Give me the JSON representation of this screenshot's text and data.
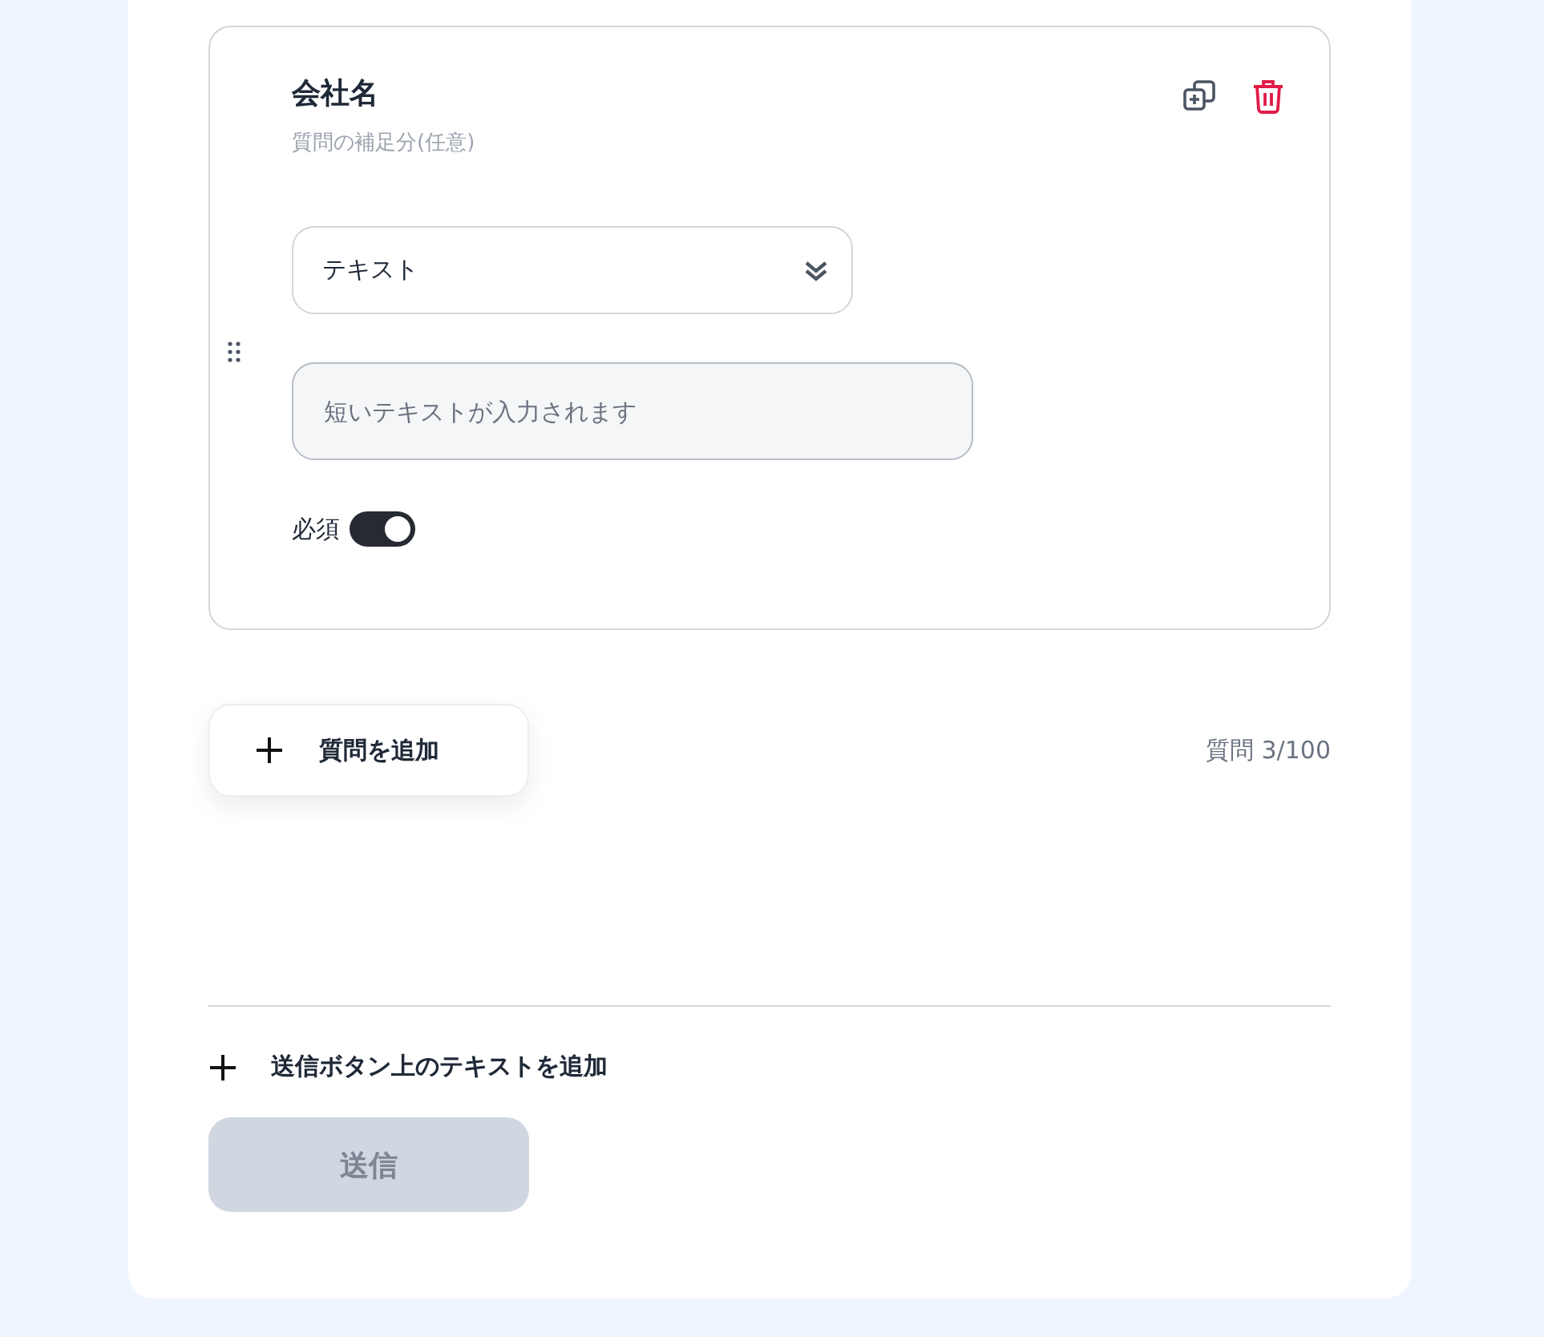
{
  "question": {
    "title": "会社名",
    "description_placeholder": "質問の補足分(任意)",
    "answer_type": "テキスト",
    "answer_placeholder": "短いテキストが入力されます",
    "required": {
      "label": "必須",
      "on": true
    }
  },
  "add_question": {
    "label": "質問を追加"
  },
  "question_count": "質問 3/100",
  "add_submit_text": {
    "label": "送信ボタン上のテキストを追加"
  },
  "submit": {
    "label": "送信",
    "disabled": true
  }
}
